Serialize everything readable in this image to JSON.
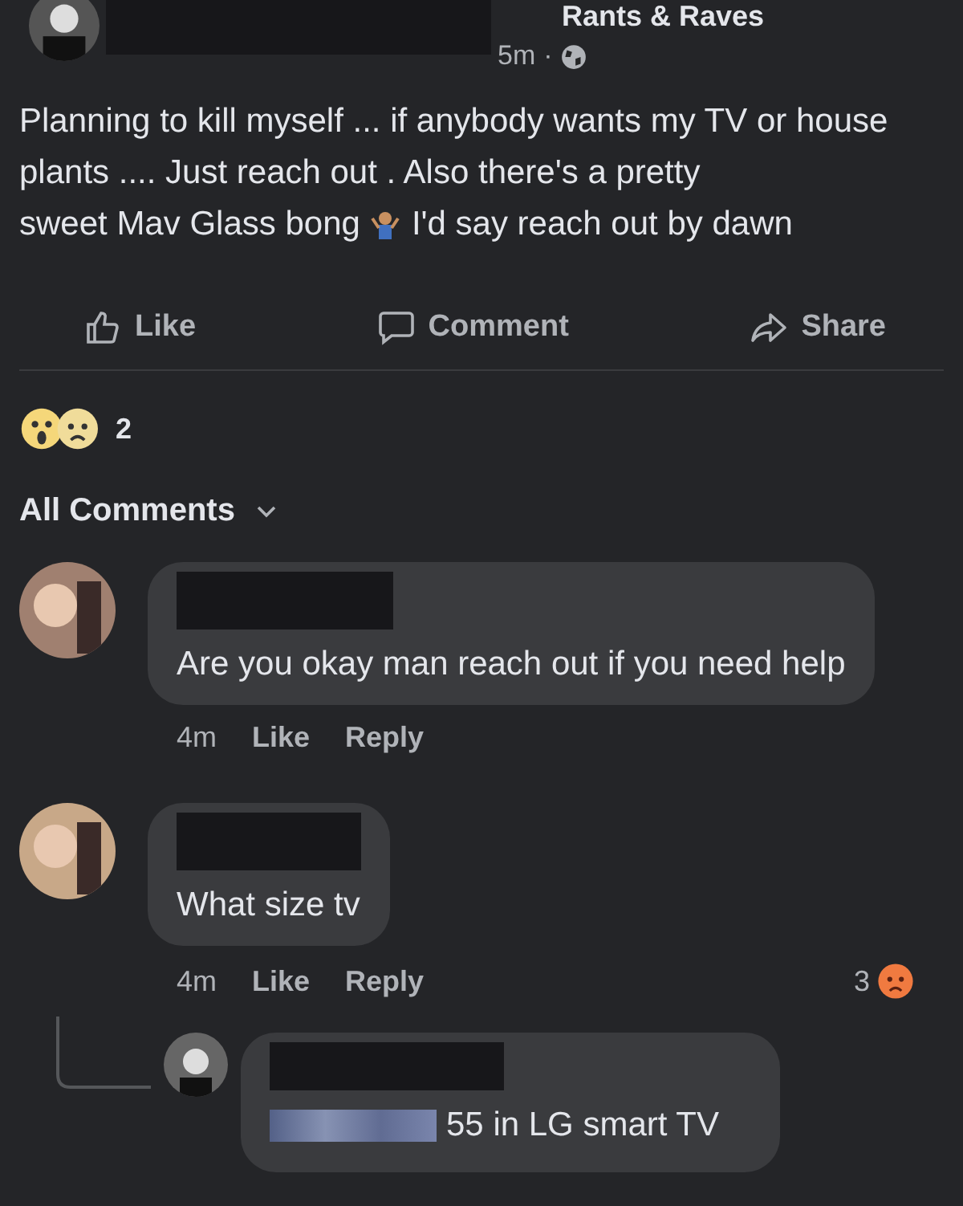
{
  "post": {
    "group": "Rants & Raves",
    "time": "5m",
    "separator": "·",
    "text_before": "Planning to kill myself ... if anybody wants my TV or house plants .... Just reach out . Also there's a pretty",
    "text_middle": "sweet Mav Glass bong",
    "text_after": "I'd say reach out by dawn"
  },
  "actions": [
    {
      "kind": "like",
      "label": "Like"
    },
    {
      "kind": "comment",
      "label": "Comment"
    },
    {
      "kind": "share",
      "label": "Share"
    }
  ],
  "reactions": {
    "count": "2"
  },
  "comments_header": {
    "label": "All Comments"
  },
  "comments": [
    {
      "text": "Are you okay man reach out if you need help",
      "time": "4m",
      "like": "Like",
      "reply": "Reply"
    },
    {
      "text": "What size tv",
      "time": "4m",
      "like": "Like",
      "reply": "Reply",
      "reaction_count": "3",
      "children": [
        {
          "text": "55 in LG smart TV",
          "mention": true
        }
      ]
    }
  ]
}
